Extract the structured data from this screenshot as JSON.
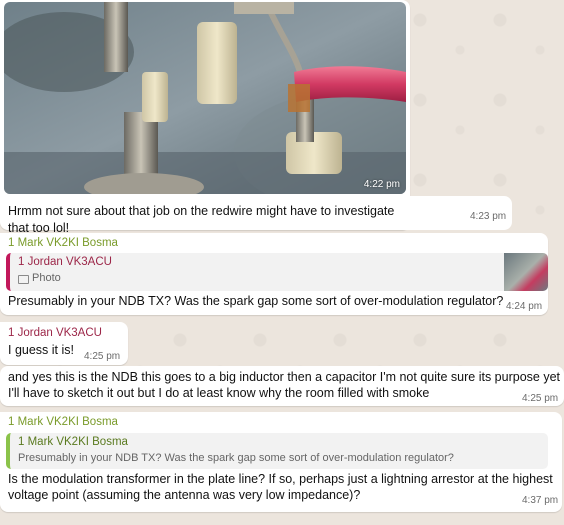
{
  "colors": {
    "chat_bg": "#ece5dd",
    "bubble_bg": "#ffffff",
    "sender_green": "#7a9b2a",
    "sender_maroon": "#9c2648",
    "quote_border_pink": "#c2185b",
    "quote_border_green": "#8bc34a",
    "time_gray": "#6b6b6b"
  },
  "messages": [
    {
      "image_time": "4:22 pm",
      "text": "Hrmm not sure about that job on the redwire might have to investigate that too lol!",
      "time": "4:23 pm"
    },
    {
      "sender": "1 Mark VK2KI Bosma",
      "quote": {
        "sender": "1 Jordan VK3ACU",
        "icon": "photo-icon",
        "text": "Photo"
      },
      "text": "Presumably in your NDB TX? Was the spark gap some sort of over-modulation regulator?",
      "time": "4:24 pm"
    },
    {
      "sender": "1 Jordan VK3ACU",
      "text": "I guess it is!",
      "time": "4:25 pm"
    },
    {
      "text_line1": "and yes this is the NDB this goes to a big inductor then a capacitor I'm not quite sure its purpose yet",
      "text_line2": "I'll have to sketch it out but I do at least know why the room filled with smoke",
      "time": "4:25 pm"
    },
    {
      "sender": "1 Mark VK2KI Bosma",
      "quote": {
        "sender": "1 Mark VK2KI Bosma",
        "text": "Presumably in your NDB TX? Was the spark gap some sort of over-modulation regulator?"
      },
      "text_line1": "Is the modulation transformer in the plate line?  If so, perhaps just a lightning arrestor at the highest",
      "text_line2": "voltage point (assuming the antenna was very low impedance)?",
      "time": "4:37 pm"
    }
  ]
}
